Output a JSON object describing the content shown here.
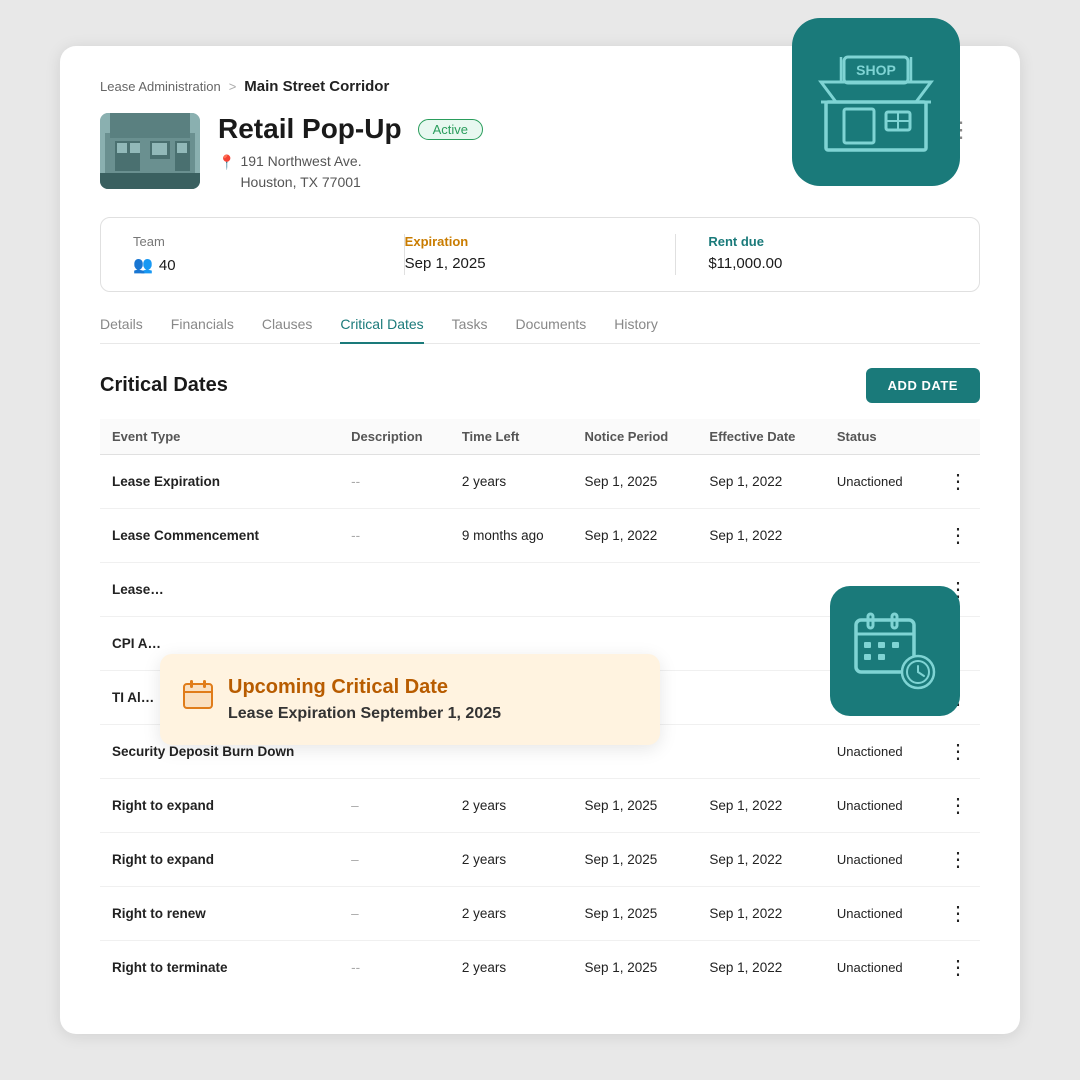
{
  "breadcrumb": {
    "parent": "Lease Administration",
    "separator": ">",
    "current": "Main Street Corridor"
  },
  "property": {
    "name": "Retail Pop-Up",
    "status": "Active",
    "address_line1": "191 Northwest Ave.",
    "address_line2": "Houston, TX 77001"
  },
  "info_bar": {
    "team_label": "Team",
    "team_value": "40",
    "expiration_label": "Expiration",
    "expiration_value": "Sep 1, 2025",
    "rent_label": "Rent due",
    "rent_value": "$11,000.00"
  },
  "tabs": [
    {
      "id": "details",
      "label": "Details"
    },
    {
      "id": "financials",
      "label": "Financials"
    },
    {
      "id": "clauses",
      "label": "Clauses"
    },
    {
      "id": "critical-dates",
      "label": "Critical Dates",
      "active": true
    },
    {
      "id": "tasks",
      "label": "Tasks"
    },
    {
      "id": "documents",
      "label": "Documents"
    },
    {
      "id": "history",
      "label": "History"
    }
  ],
  "section_title": "Critical Dates",
  "add_date_button": "ADD DATE",
  "table": {
    "headers": [
      "Event Type",
      "Description",
      "Time Left",
      "Notice Period",
      "Effective Date",
      "Status"
    ],
    "rows": [
      {
        "event_type": "Lease Expiration",
        "description": "--",
        "time_left": "2 years",
        "notice_period": "Sep 1, 2025",
        "effective_date": "Sep 1, 2022",
        "status": "Unactioned"
      },
      {
        "event_type": "Lease Commencement",
        "description": "--",
        "time_left": "9 months ago",
        "notice_period": "Sep 1, 2022",
        "effective_date": "Sep 1, 2022",
        "status": ""
      },
      {
        "event_type": "Lease…",
        "description": "",
        "time_left": "",
        "notice_period": "",
        "effective_date": "",
        "status": ""
      },
      {
        "event_type": "CPI A…",
        "description": "",
        "time_left": "",
        "notice_period": "",
        "effective_date": "",
        "status": ""
      },
      {
        "event_type": "TI Al…",
        "description": "",
        "time_left": "",
        "notice_period": "",
        "effective_date": "",
        "status": ""
      },
      {
        "event_type": "Security Deposit Burn Down",
        "description": "",
        "time_left": "",
        "notice_period": "",
        "effective_date": "",
        "status": "Unactioned"
      },
      {
        "event_type": "Right to expand",
        "description": "–",
        "time_left": "2 years",
        "notice_period": "Sep 1, 2025",
        "effective_date": "Sep 1, 2022",
        "status": "Unactioned"
      },
      {
        "event_type": "Right to expand",
        "description": "–",
        "time_left": "2 years",
        "notice_period": "Sep 1, 2025",
        "effective_date": "Sep 1, 2022",
        "status": "Unactioned"
      },
      {
        "event_type": "Right to renew",
        "description": "–",
        "time_left": "2 years",
        "notice_period": "Sep 1, 2025",
        "effective_date": "Sep 1, 2022",
        "status": "Unactioned"
      },
      {
        "event_type": "Right to terminate",
        "description": "--",
        "time_left": "2 years",
        "notice_period": "Sep 1, 2025",
        "effective_date": "Sep 1, 2022",
        "status": "Unactioned"
      }
    ]
  },
  "tooltip": {
    "title": "Upcoming Critical Date",
    "body": "Lease Expiration September 1, 2025",
    "icon": "📅"
  },
  "colors": {
    "teal": "#1a7a7a",
    "orange": "#e07c1a",
    "active_green": "#2a9d5c"
  }
}
